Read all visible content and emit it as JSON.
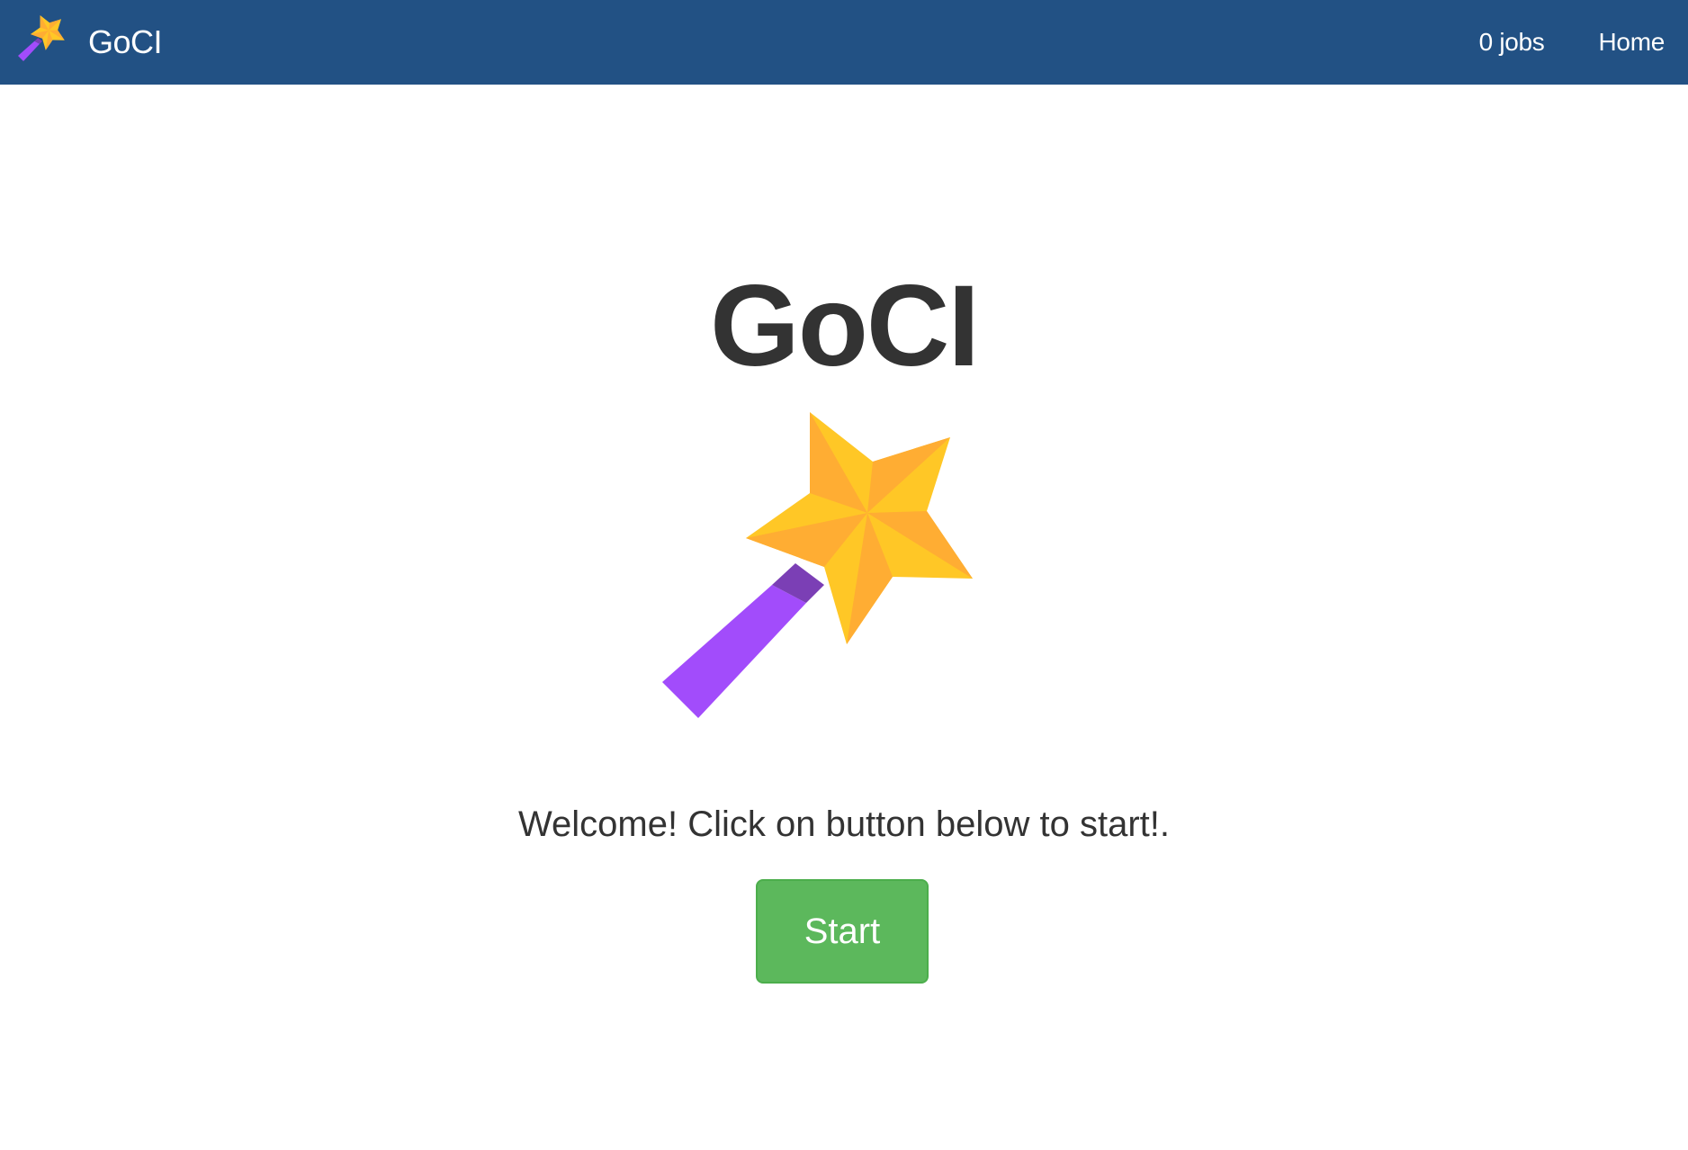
{
  "navbar": {
    "brand_icon": "magic-wand-icon",
    "brand_text": "GoCI",
    "links": [
      {
        "label": "0 jobs"
      },
      {
        "label": "Home"
      }
    ],
    "background_color": "#225184"
  },
  "main": {
    "title": "GoCI",
    "hero_icon": "magic-wand-icon",
    "welcome_text": "Welcome! Click on button below to start!.",
    "start_button_label": "Start",
    "start_button_color": "#5cb85c"
  }
}
